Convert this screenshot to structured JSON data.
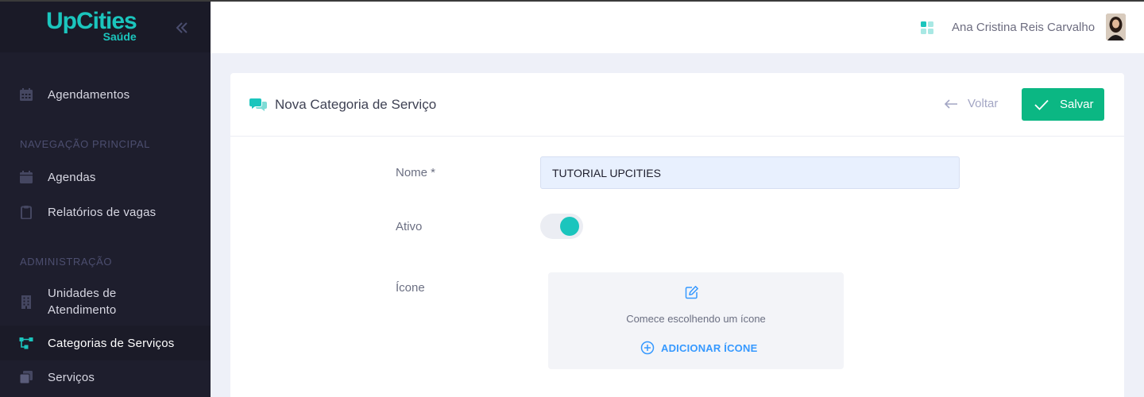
{
  "brand": {
    "name": "UpCities",
    "sub": "Saúde"
  },
  "sidebar": {
    "items": [
      {
        "label": "Agendamentos"
      },
      {
        "label": "Agendas"
      },
      {
        "label": "Relatórios de vagas"
      },
      {
        "label": "Unidades de Atendimento"
      },
      {
        "label": "Categorias de Serviços"
      },
      {
        "label": "Serviços"
      }
    ],
    "sections": [
      "NAVEGAÇÃO PRINCIPAL",
      "ADMINISTRAÇÃO"
    ],
    "active_index": 4
  },
  "header": {
    "user_name": "Ana Cristina Reis Carvalho"
  },
  "card": {
    "title": "Nova Categoria de Serviço",
    "back_label": "Voltar",
    "save_label": "Salvar"
  },
  "form": {
    "name_label": "Nome *",
    "name_value": "TUTORIAL UPCITIES",
    "active_label": "Ativo",
    "active_value": true,
    "icon_label": "Ícone",
    "icon_hint": "Comece escolhendo um ícone",
    "add_icon_label": "ADICIONAR ÍCONE"
  },
  "colors": {
    "sidebar_bg": "#1e1e2d",
    "accent_teal": "#1bc5bd",
    "save_green": "#0bb783",
    "link_blue": "#3699ff"
  }
}
